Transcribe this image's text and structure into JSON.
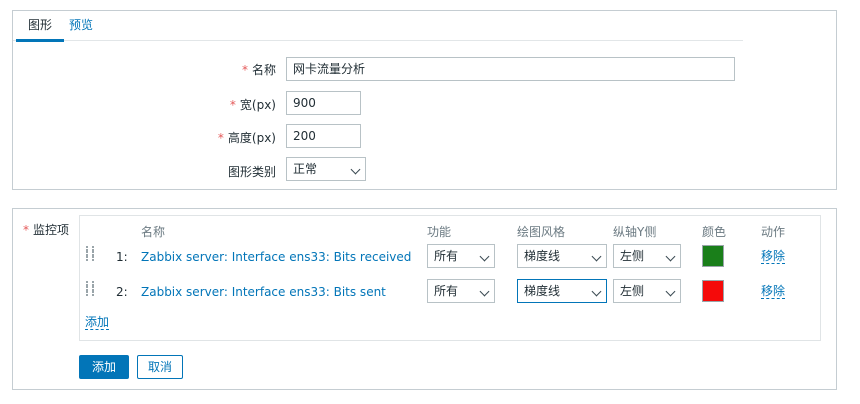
{
  "tabs": [
    {
      "label": "图形"
    },
    {
      "label": "预览"
    }
  ],
  "form": {
    "name": {
      "label": "名称",
      "required_mark": "*",
      "value": "网卡流量分析"
    },
    "width": {
      "label": "宽(px)",
      "required_mark": "*",
      "value": "900"
    },
    "height": {
      "label": "高度(px)",
      "required_mark": "*",
      "value": "200"
    },
    "graph_type": {
      "label": "图形类别",
      "value": "正常"
    }
  },
  "items_section": {
    "label": "监控项",
    "required_mark": "*",
    "headers": {
      "name": "名称",
      "function": "功能",
      "draw_style": "绘图风格",
      "y_axis_side": "纵轴Y侧",
      "color": "颜色",
      "action": "动作"
    },
    "rows": [
      {
        "number": "1:",
        "name": "Zabbix server: Interface ens33: Bits received",
        "function": "所有",
        "draw_style": "梯度线",
        "y_axis_side": "左侧",
        "color": "#1a7f1a",
        "action": "移除"
      },
      {
        "number": "2:",
        "name": "Zabbix server: Interface ens33: Bits sent",
        "function": "所有",
        "draw_style": "梯度线",
        "y_axis_side": "左侧",
        "color": "#f50a0a",
        "action": "移除"
      }
    ],
    "add_link": "添加"
  },
  "buttons": {
    "add": "添加",
    "cancel": "取消"
  },
  "colors": {
    "accent": "#0275b8",
    "required": "#e45959"
  }
}
